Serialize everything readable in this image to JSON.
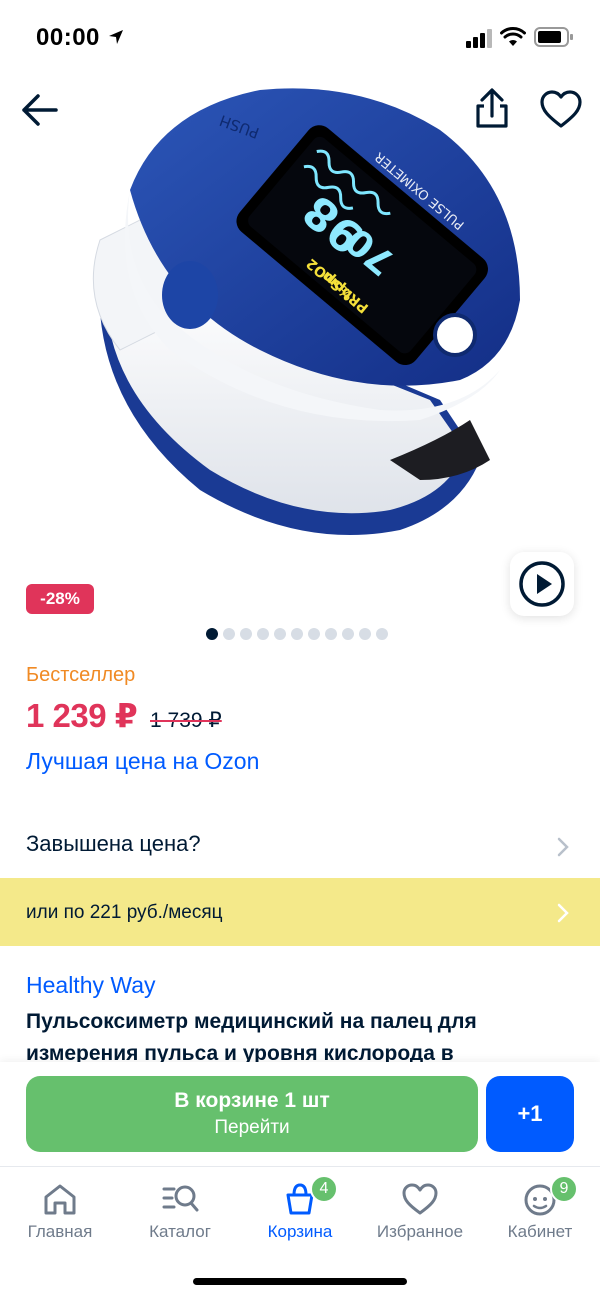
{
  "status_bar": {
    "time": "00:00"
  },
  "product": {
    "discount": "-28%",
    "image_text": {
      "brand": "PUSH",
      "model": "PULSE OXIMETER",
      "spo2_value": "98",
      "pr_value": "70",
      "spo2_label": "%SpO2",
      "pr_label": "PRbpm"
    },
    "gallery_total": 11,
    "gallery_active": 0,
    "bestseller": "Бестселлер",
    "price": "1 239 ₽",
    "old_price": "1 739 ₽",
    "best_price": "Лучшая цена на Ozon",
    "overpriced": "Завышена цена?",
    "installment": "или по 221 руб./месяц",
    "brand": "Healthy Way",
    "title": "Пульсоксиметр медицинский на палец для измерения пульса и уровня кислорода в"
  },
  "cart": {
    "main_label": "В корзине 1 шт",
    "sub_label": "Перейти",
    "plus_label": "+1"
  },
  "bottom_nav": {
    "items": [
      {
        "label": "Главная",
        "icon": "home-icon"
      },
      {
        "label": "Каталог",
        "icon": "catalog-icon"
      },
      {
        "label": "Корзина",
        "icon": "cart-icon",
        "badge": "4",
        "active": true
      },
      {
        "label": "Избранное",
        "icon": "heart-icon"
      },
      {
        "label": "Кабинет",
        "icon": "profile-icon",
        "badge": "9"
      }
    ]
  },
  "colors": {
    "accent": "#005bff",
    "price": "#e0345a",
    "bestseller": "#f08a24",
    "cart_green": "#66c06d",
    "installment_bg": "#f4e98a"
  }
}
